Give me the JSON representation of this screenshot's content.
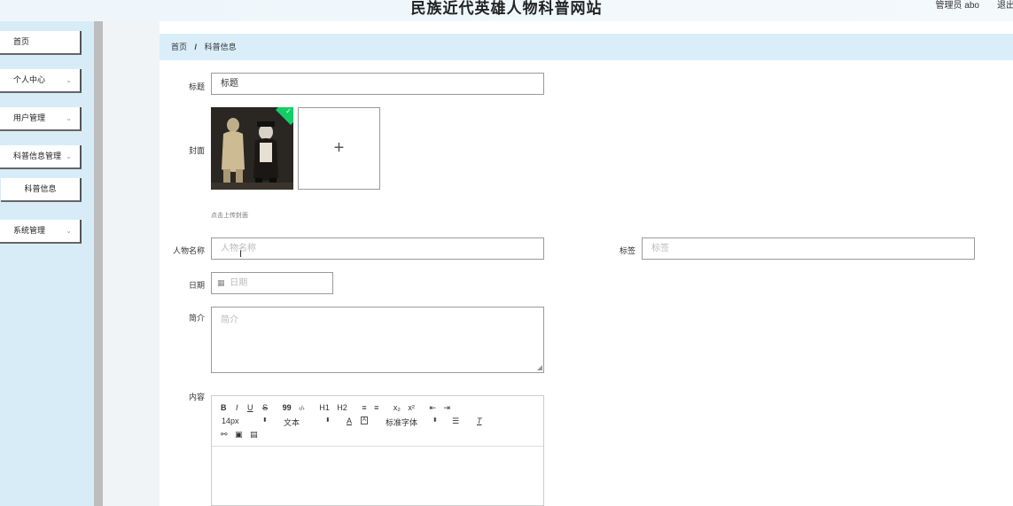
{
  "header": {
    "title": "民族近代英雄人物科普网站",
    "admin_label": "管理员 abo",
    "logout_label": "退出"
  },
  "sidebar": {
    "items": [
      {
        "label": "首页",
        "has_chevron": false
      },
      {
        "label": "个人中心",
        "has_chevron": true
      },
      {
        "label": "用户管理",
        "has_chevron": true
      },
      {
        "label": "科普信息管理",
        "has_chevron": true
      },
      {
        "label": "科普信息",
        "submenu": true
      },
      {
        "label": "系统管理",
        "has_chevron": true
      }
    ],
    "chevron": "⌄"
  },
  "breadcrumb": {
    "home": "首页",
    "separator": "/",
    "current": "科普信息"
  },
  "form": {
    "title_label": "标题",
    "title_value": "标题",
    "cover_label": "封面",
    "upload_hint": "点击上传封面",
    "upload_plus": "+",
    "name_label": "人物名称",
    "name_placeholder": "人物名称",
    "tag_label": "标签",
    "tag_placeholder": "标签",
    "date_label": "日期",
    "date_placeholder": "日期",
    "intro_label": "简介",
    "intro_placeholder": "简介",
    "content_label": "内容"
  },
  "editor": {
    "row1": [
      "B",
      "I",
      "U",
      "S",
      "99",
      "‹/›",
      "H1",
      "H2",
      "≡",
      "≡",
      "x₂",
      "x²",
      "⇤",
      "⇥"
    ],
    "font_size": "14px",
    "text_type": "文本",
    "font_family": "标准字体"
  },
  "colors": {
    "sidebar_bg": "#d8ecf8",
    "breadcrumb_bg": "#d9eef9",
    "success_badge": "#13ce66"
  }
}
